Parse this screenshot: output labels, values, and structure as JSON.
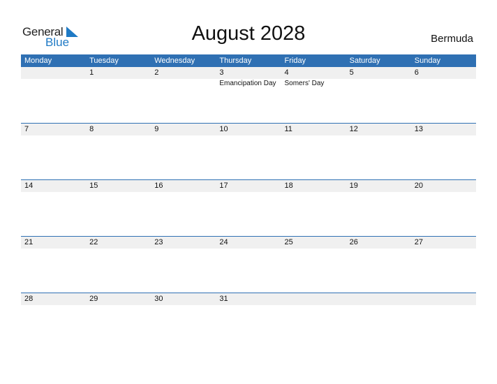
{
  "logo": {
    "general": "General",
    "blue": "Blue"
  },
  "title": "August 2028",
  "country": "Bermuda",
  "weekdays": [
    "Monday",
    "Tuesday",
    "Wednesday",
    "Thursday",
    "Friday",
    "Saturday",
    "Sunday"
  ],
  "weeks": [
    {
      "days": [
        "",
        "1",
        "2",
        "3",
        "4",
        "5",
        "6"
      ],
      "holidays": [
        "",
        "",
        "",
        "Emancipation Day",
        "Somers' Day",
        "",
        ""
      ]
    },
    {
      "days": [
        "7",
        "8",
        "9",
        "10",
        "11",
        "12",
        "13"
      ],
      "holidays": [
        "",
        "",
        "",
        "",
        "",
        "",
        ""
      ]
    },
    {
      "days": [
        "14",
        "15",
        "16",
        "17",
        "18",
        "19",
        "20"
      ],
      "holidays": [
        "",
        "",
        "",
        "",
        "",
        "",
        ""
      ]
    },
    {
      "days": [
        "21",
        "22",
        "23",
        "24",
        "25",
        "26",
        "27"
      ],
      "holidays": [
        "",
        "",
        "",
        "",
        "",
        "",
        ""
      ]
    },
    {
      "days": [
        "28",
        "29",
        "30",
        "31",
        "",
        "",
        ""
      ],
      "holidays": [
        "",
        "",
        "",
        "",
        "",
        "",
        ""
      ]
    }
  ],
  "colors": {
    "accent": "#2f70b3",
    "row_bg": "#f0f0f0",
    "logo_blue": "#1f7ac5"
  }
}
